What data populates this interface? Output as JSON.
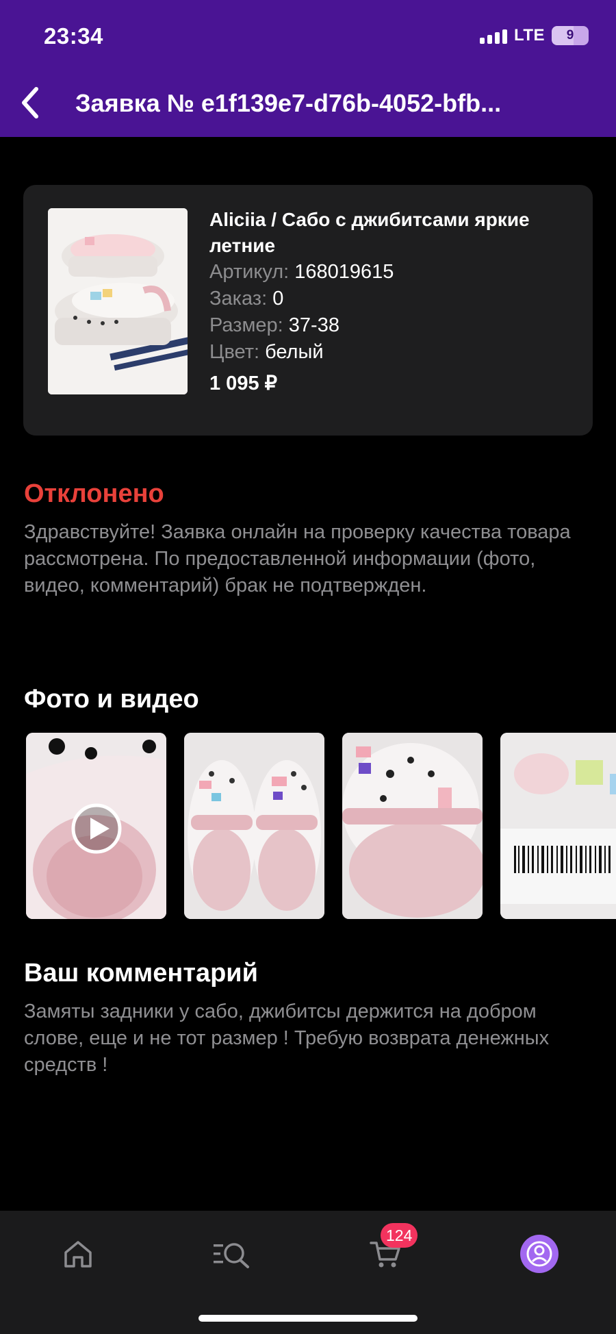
{
  "status_bar": {
    "time": "23:34",
    "network": "LTE",
    "battery": "9"
  },
  "header": {
    "title": "Заявка № e1f139e7-d76b-4052-bfb..."
  },
  "product": {
    "name": "Aliciia / Сабо с джибитсами яркие летние",
    "article_label": "Артикул:",
    "article_value": "168019615",
    "order_label": "Заказ:",
    "order_value": "0",
    "size_label": "Размер:",
    "size_value": "37-38",
    "color_label": "Цвет:",
    "color_value": "белый",
    "price": "1 095 ₽"
  },
  "status": {
    "title": "Отклонено",
    "text": "Здравствуйте! Заявка онлайн на проверку качества товара рассмотрена. По предоставленной информации (фото, видео, комментарий) брак не подтвержден."
  },
  "photos": {
    "title": "Фото и видео"
  },
  "comment": {
    "title": "Ваш комментарий",
    "text": "Замяты задники у сабо, джибитсы держится на добром слове, еще и не тот размер ! Требую возврата денежных средств !"
  },
  "nav": {
    "cart_badge": "124"
  },
  "colors": {
    "header": "#4a1494",
    "status_rejected": "#e8413a",
    "badge": "#f2335e",
    "profile": "#a268f0"
  }
}
